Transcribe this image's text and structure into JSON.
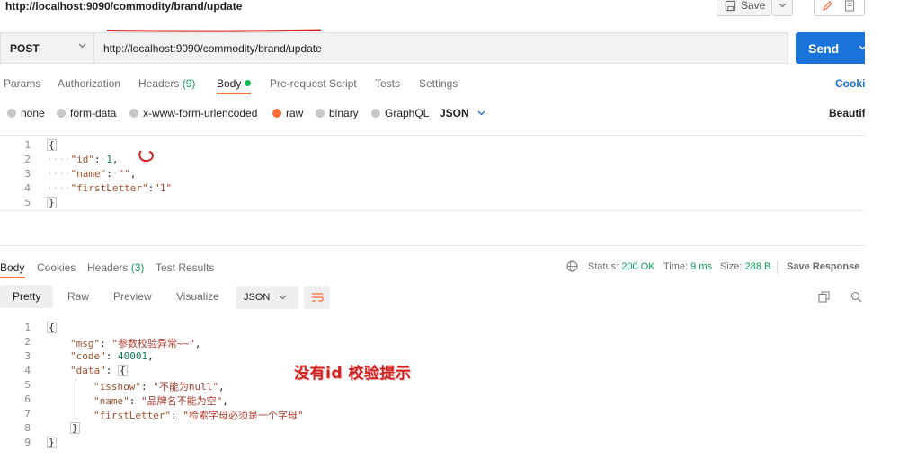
{
  "window": {
    "title": "http://localhost:9090/commodity/brand/update",
    "save_label": "Save"
  },
  "request": {
    "method": "POST",
    "url": "http://localhost:9090/commodity/brand/update",
    "send_label": "Send"
  },
  "request_tabs": {
    "params": "Params",
    "authorization": "Authorization",
    "headers": "Headers",
    "headers_count": "(9)",
    "body": "Body",
    "prerequest": "Pre-request Script",
    "tests": "Tests",
    "settings": "Settings",
    "cookies": "Cooki"
  },
  "body_types": {
    "none": "none",
    "form_data": "form-data",
    "urlencoded": "x-www-form-urlencoded",
    "raw": "raw",
    "binary": "binary",
    "graphql": "GraphQL",
    "format": "JSON",
    "beautify": "Beautif"
  },
  "request_body": {
    "line_numbers": [
      "1",
      "2",
      "3",
      "4",
      "5"
    ],
    "open": "{",
    "l2_key": "\"id\"",
    "l2_val": "1",
    "l3_key": "\"name\"",
    "l3_val": "\"\"",
    "l4_key": "\"firstLetter\"",
    "l4_val": "\"1\"",
    "close": "}"
  },
  "response_tabs": {
    "body": "Body",
    "cookies": "Cookies",
    "headers": "Headers",
    "headers_count": "(3)",
    "test_results": "Test Results",
    "status_label": "Status:",
    "status_value": "200 OK",
    "time_label": "Time:",
    "time_value": "9 ms",
    "size_label": "Size:",
    "size_value": "288 B",
    "save_response": "Save Response"
  },
  "response_toolbar": {
    "pretty": "Pretty",
    "raw": "Raw",
    "preview": "Preview",
    "visualize": "Visualize",
    "format": "JSON"
  },
  "response_body": {
    "line_numbers": [
      "1",
      "2",
      "3",
      "4",
      "5",
      "6",
      "7",
      "8",
      "9"
    ],
    "open": "{",
    "msg_key": "\"msg\"",
    "msg_val": "\"参数校验异常~~\"",
    "code_key": "\"code\"",
    "code_val": "40001",
    "data_key": "\"data\"",
    "data_open": "{",
    "isshow_key": "\"isshow\"",
    "isshow_val": "\"不能为null\"",
    "name_key": "\"name\"",
    "name_val": "\"品牌名不能为空\"",
    "fl_key": "\"firstLetter\"",
    "fl_val": "\"检索字母必须是一个字母\"",
    "data_close": "}",
    "close": "}"
  },
  "annotation": {
    "text": "没有id 校验提示"
  },
  "colors": {
    "send_button": "#1a73d9",
    "active_tab_underline": "#ff6c37",
    "status_ok": "#0f9d58",
    "annotation_red": "#d22020"
  }
}
